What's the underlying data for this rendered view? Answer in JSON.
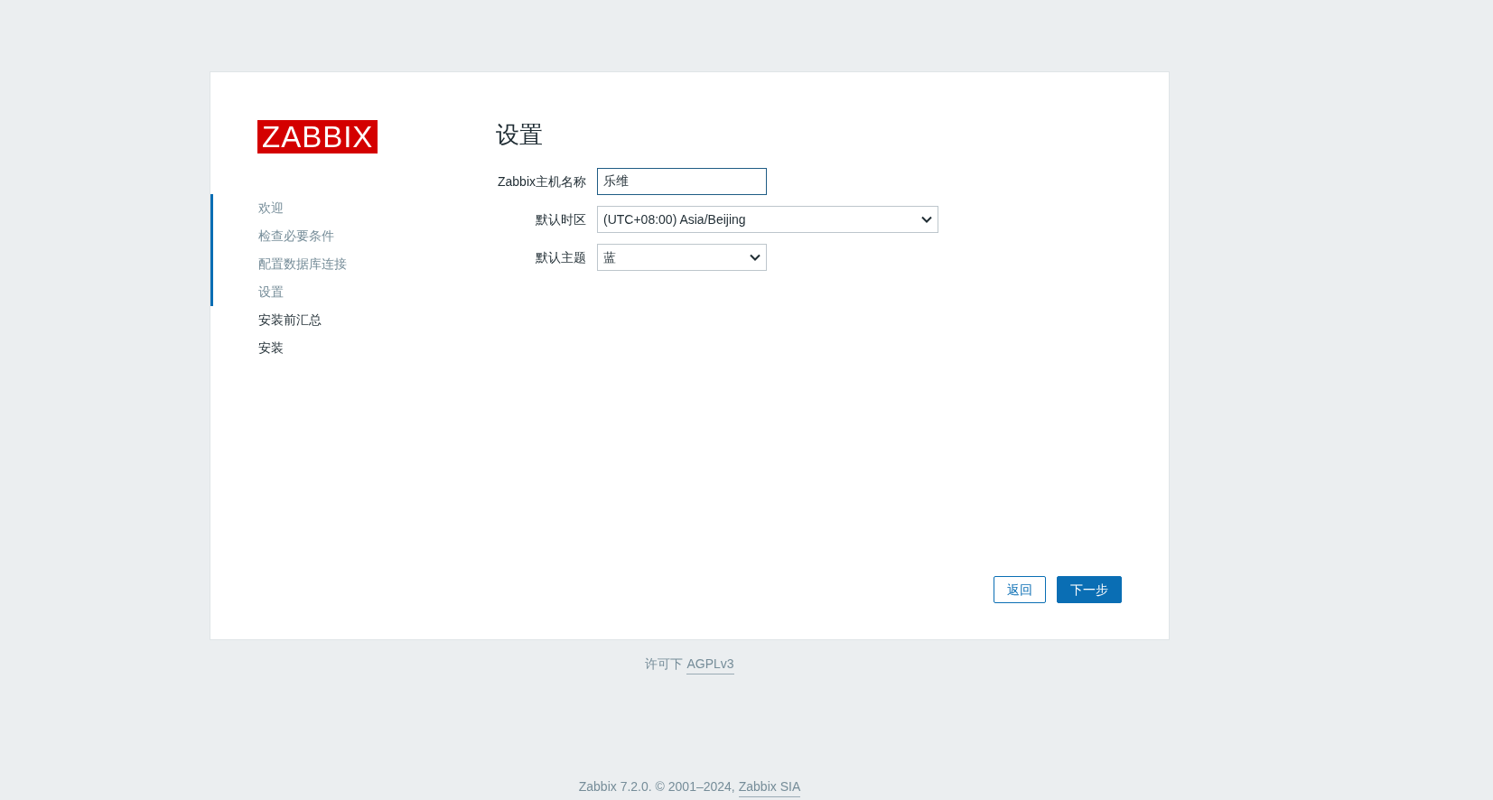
{
  "logo": {
    "text": "ZABBIX"
  },
  "steps": [
    {
      "label": "欢迎",
      "done": true
    },
    {
      "label": "检查必要条件",
      "done": true
    },
    {
      "label": "配置数据库连接",
      "done": true
    },
    {
      "label": "设置",
      "done": true
    },
    {
      "label": "安装前汇总",
      "done": false
    },
    {
      "label": "安装",
      "done": false
    }
  ],
  "title": "设置",
  "fields": [
    {
      "kind": "text",
      "label": "Zabbix主机名称",
      "value": "乐维",
      "focused": true,
      "wide": false
    },
    {
      "kind": "select",
      "label": "默认时区",
      "value": "(UTC+08:00) Asia/Beijing",
      "focused": false,
      "wide": true
    },
    {
      "kind": "select",
      "label": "默认主题",
      "value": "蓝",
      "focused": false,
      "wide": false
    }
  ],
  "buttons": [
    {
      "label": "返回",
      "primary": false
    },
    {
      "label": "下一步",
      "primary": true
    }
  ],
  "license": {
    "text": "许可下",
    "link": "AGPLv3"
  },
  "copyright": {
    "text": "Zabbix 7.2.0. © 2001–2024,",
    "link": "Zabbix SIA"
  }
}
